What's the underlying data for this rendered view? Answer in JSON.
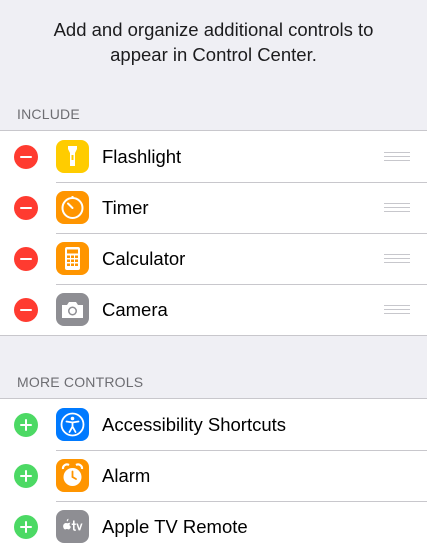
{
  "header": {
    "description_line1": "Add and organize additional controls to",
    "description_line2": "appear in Control Center."
  },
  "include": {
    "section_label": "INCLUDE",
    "items": [
      {
        "label": "Flashlight",
        "icon": "flashlight-icon",
        "icon_color": "#ffcc00",
        "action": "remove"
      },
      {
        "label": "Timer",
        "icon": "timer-icon",
        "icon_color": "#ff9500",
        "action": "remove"
      },
      {
        "label": "Calculator",
        "icon": "calculator-icon",
        "icon_color": "#ff9500",
        "action": "remove"
      },
      {
        "label": "Camera",
        "icon": "camera-icon",
        "icon_color": "#8e8e93",
        "action": "remove"
      }
    ]
  },
  "more_controls": {
    "section_label": "MORE CONTROLS",
    "items": [
      {
        "label": "Accessibility Shortcuts",
        "icon": "accessibility-icon",
        "icon_color": "#007aff",
        "action": "add"
      },
      {
        "label": "Alarm",
        "icon": "alarm-icon",
        "icon_color": "#ff9500",
        "action": "add"
      },
      {
        "label": "Apple TV Remote",
        "icon": "apple-tv-icon",
        "icon_color": "#8e8e93",
        "action": "add"
      }
    ]
  },
  "colors": {
    "remove": "#ff3b30",
    "add": "#4cd964",
    "background": "#efeff4",
    "separator": "#c8c7cc",
    "section_label": "#6d6d72"
  }
}
